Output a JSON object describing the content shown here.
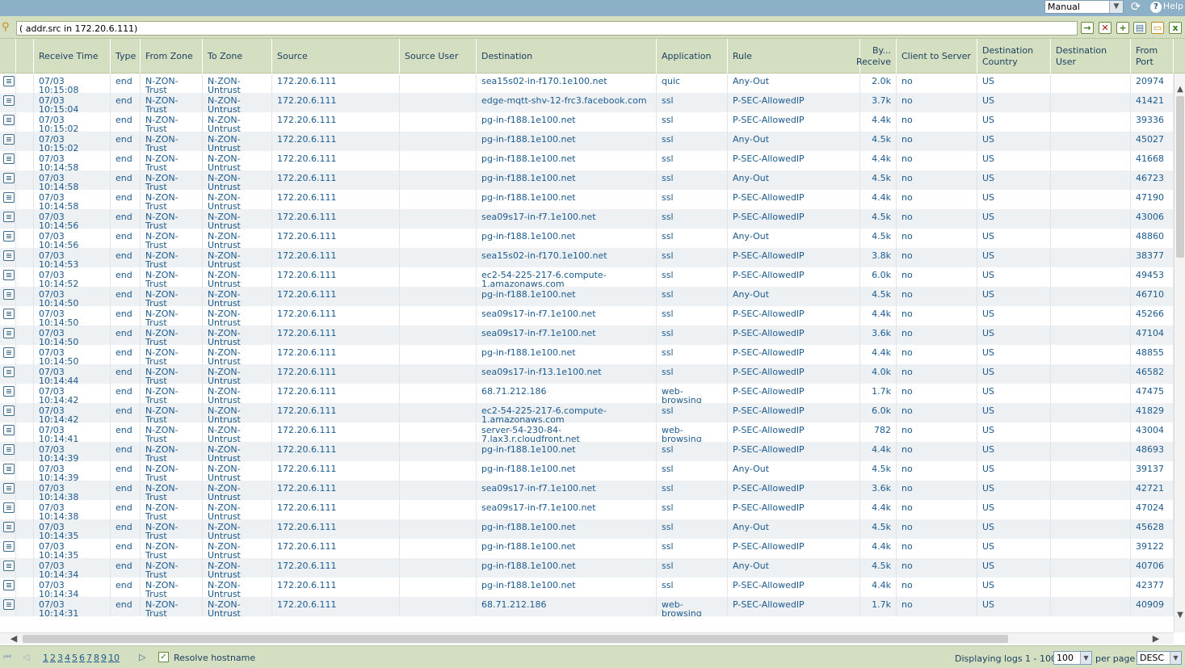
{
  "topbar": {
    "mode": "Manual",
    "help_label": "Help"
  },
  "filter": {
    "query": "( addr.src in 172.20.6.111)"
  },
  "columns": [
    {
      "key": "icon",
      "label": ""
    },
    {
      "key": "time",
      "label": "Receive Time"
    },
    {
      "key": "type",
      "label": "Type"
    },
    {
      "key": "from_zone",
      "label": "From Zone"
    },
    {
      "key": "to_zone",
      "label": "To Zone"
    },
    {
      "key": "source",
      "label": "Source"
    },
    {
      "key": "source_user",
      "label": "Source User"
    },
    {
      "key": "destination",
      "label": "Destination"
    },
    {
      "key": "application",
      "label": "Application"
    },
    {
      "key": "rule",
      "label": "Rule"
    },
    {
      "key": "bytes",
      "label": "By... Receive"
    },
    {
      "key": "c2s",
      "label": "Client to Server"
    },
    {
      "key": "dest_country",
      "label": "Destination Country"
    },
    {
      "key": "dest_user",
      "label": "Destination User"
    },
    {
      "key": "from_port",
      "label": "From Port"
    }
  ],
  "rows": [
    {
      "time": "07/03 10:15:08",
      "type": "end",
      "from_zone": "N-ZON-Trust",
      "to_zone": "N-ZON-Untrust",
      "source": "172.20.6.111",
      "source_user": "",
      "destination": "sea15s02-in-f170.1e100.net",
      "application": "quic",
      "rule": "Any-Out",
      "bytes": "2.0k",
      "c2s": "no",
      "dest_country": "US",
      "dest_user": "",
      "from_port": "20974"
    },
    {
      "time": "07/03 10:15:04",
      "type": "end",
      "from_zone": "N-ZON-Trust",
      "to_zone": "N-ZON-Untrust",
      "source": "172.20.6.111",
      "source_user": "",
      "destination": "edge-mqtt-shv-12-frc3.facebook.com",
      "application": "ssl",
      "rule": "P-SEC-AllowedIP",
      "bytes": "3.7k",
      "c2s": "no",
      "dest_country": "US",
      "dest_user": "",
      "from_port": "41421"
    },
    {
      "time": "07/03 10:15:02",
      "type": "end",
      "from_zone": "N-ZON-Trust",
      "to_zone": "N-ZON-Untrust",
      "source": "172.20.6.111",
      "source_user": "",
      "destination": "pg-in-f188.1e100.net",
      "application": "ssl",
      "rule": "P-SEC-AllowedIP",
      "bytes": "4.4k",
      "c2s": "no",
      "dest_country": "US",
      "dest_user": "",
      "from_port": "39336"
    },
    {
      "time": "07/03 10:15:02",
      "type": "end",
      "from_zone": "N-ZON-Trust",
      "to_zone": "N-ZON-Untrust",
      "source": "172.20.6.111",
      "source_user": "",
      "destination": "pg-in-f188.1e100.net",
      "application": "ssl",
      "rule": "Any-Out",
      "bytes": "4.5k",
      "c2s": "no",
      "dest_country": "US",
      "dest_user": "",
      "from_port": "45027"
    },
    {
      "time": "07/03 10:14:58",
      "type": "end",
      "from_zone": "N-ZON-Trust",
      "to_zone": "N-ZON-Untrust",
      "source": "172.20.6.111",
      "source_user": "",
      "destination": "pg-in-f188.1e100.net",
      "application": "ssl",
      "rule": "P-SEC-AllowedIP",
      "bytes": "4.4k",
      "c2s": "no",
      "dest_country": "US",
      "dest_user": "",
      "from_port": "41668"
    },
    {
      "time": "07/03 10:14:58",
      "type": "end",
      "from_zone": "N-ZON-Trust",
      "to_zone": "N-ZON-Untrust",
      "source": "172.20.6.111",
      "source_user": "",
      "destination": "pg-in-f188.1e100.net",
      "application": "ssl",
      "rule": "Any-Out",
      "bytes": "4.5k",
      "c2s": "no",
      "dest_country": "US",
      "dest_user": "",
      "from_port": "46723"
    },
    {
      "time": "07/03 10:14:58",
      "type": "end",
      "from_zone": "N-ZON-Trust",
      "to_zone": "N-ZON-Untrust",
      "source": "172.20.6.111",
      "source_user": "",
      "destination": "pg-in-f188.1e100.net",
      "application": "ssl",
      "rule": "P-SEC-AllowedIP",
      "bytes": "4.4k",
      "c2s": "no",
      "dest_country": "US",
      "dest_user": "",
      "from_port": "47190"
    },
    {
      "time": "07/03 10:14:56",
      "type": "end",
      "from_zone": "N-ZON-Trust",
      "to_zone": "N-ZON-Untrust",
      "source": "172.20.6.111",
      "source_user": "",
      "destination": "sea09s17-in-f7.1e100.net",
      "application": "ssl",
      "rule": "P-SEC-AllowedIP",
      "bytes": "4.5k",
      "c2s": "no",
      "dest_country": "US",
      "dest_user": "",
      "from_port": "43006"
    },
    {
      "time": "07/03 10:14:56",
      "type": "end",
      "from_zone": "N-ZON-Trust",
      "to_zone": "N-ZON-Untrust",
      "source": "172.20.6.111",
      "source_user": "",
      "destination": "pg-in-f188.1e100.net",
      "application": "ssl",
      "rule": "Any-Out",
      "bytes": "4.5k",
      "c2s": "no",
      "dest_country": "US",
      "dest_user": "",
      "from_port": "48860"
    },
    {
      "time": "07/03 10:14:53",
      "type": "end",
      "from_zone": "N-ZON-Trust",
      "to_zone": "N-ZON-Untrust",
      "source": "172.20.6.111",
      "source_user": "",
      "destination": "sea15s02-in-f170.1e100.net",
      "application": "ssl",
      "rule": "P-SEC-AllowedIP",
      "bytes": "3.8k",
      "c2s": "no",
      "dest_country": "US",
      "dest_user": "",
      "from_port": "38377"
    },
    {
      "time": "07/03 10:14:52",
      "type": "end",
      "from_zone": "N-ZON-Trust",
      "to_zone": "N-ZON-Untrust",
      "source": "172.20.6.111",
      "source_user": "",
      "destination": "ec2-54-225-217-6.compute-1.amazonaws.com",
      "application": "ssl",
      "rule": "P-SEC-AllowedIP",
      "bytes": "6.0k",
      "c2s": "no",
      "dest_country": "US",
      "dest_user": "",
      "from_port": "49453"
    },
    {
      "time": "07/03 10:14:50",
      "type": "end",
      "from_zone": "N-ZON-Trust",
      "to_zone": "N-ZON-Untrust",
      "source": "172.20.6.111",
      "source_user": "",
      "destination": "pg-in-f188.1e100.net",
      "application": "ssl",
      "rule": "Any-Out",
      "bytes": "4.5k",
      "c2s": "no",
      "dest_country": "US",
      "dest_user": "",
      "from_port": "46710"
    },
    {
      "time": "07/03 10:14:50",
      "type": "end",
      "from_zone": "N-ZON-Trust",
      "to_zone": "N-ZON-Untrust",
      "source": "172.20.6.111",
      "source_user": "",
      "destination": "sea09s17-in-f7.1e100.net",
      "application": "ssl",
      "rule": "P-SEC-AllowedIP",
      "bytes": "4.4k",
      "c2s": "no",
      "dest_country": "US",
      "dest_user": "",
      "from_port": "45266"
    },
    {
      "time": "07/03 10:14:50",
      "type": "end",
      "from_zone": "N-ZON-Trust",
      "to_zone": "N-ZON-Untrust",
      "source": "172.20.6.111",
      "source_user": "",
      "destination": "sea09s17-in-f7.1e100.net",
      "application": "ssl",
      "rule": "P-SEC-AllowedIP",
      "bytes": "3.6k",
      "c2s": "no",
      "dest_country": "US",
      "dest_user": "",
      "from_port": "47104"
    },
    {
      "time": "07/03 10:14:50",
      "type": "end",
      "from_zone": "N-ZON-Trust",
      "to_zone": "N-ZON-Untrust",
      "source": "172.20.6.111",
      "source_user": "",
      "destination": "pg-in-f188.1e100.net",
      "application": "ssl",
      "rule": "P-SEC-AllowedIP",
      "bytes": "4.4k",
      "c2s": "no",
      "dest_country": "US",
      "dest_user": "",
      "from_port": "48855"
    },
    {
      "time": "07/03 10:14:44",
      "type": "end",
      "from_zone": "N-ZON-Trust",
      "to_zone": "N-ZON-Untrust",
      "source": "172.20.6.111",
      "source_user": "",
      "destination": "sea09s17-in-f13.1e100.net",
      "application": "ssl",
      "rule": "P-SEC-AllowedIP",
      "bytes": "4.0k",
      "c2s": "no",
      "dest_country": "US",
      "dest_user": "",
      "from_port": "46582"
    },
    {
      "time": "07/03 10:14:42",
      "type": "end",
      "from_zone": "N-ZON-Trust",
      "to_zone": "N-ZON-Untrust",
      "source": "172.20.6.111",
      "source_user": "",
      "destination": "68.71.212.186",
      "application": "web-browsing",
      "rule": "P-SEC-AllowedIP",
      "bytes": "1.7k",
      "c2s": "no",
      "dest_country": "US",
      "dest_user": "",
      "from_port": "47475"
    },
    {
      "time": "07/03 10:14:42",
      "type": "end",
      "from_zone": "N-ZON-Trust",
      "to_zone": "N-ZON-Untrust",
      "source": "172.20.6.111",
      "source_user": "",
      "destination": "ec2-54-225-217-6.compute-1.amazonaws.com",
      "application": "ssl",
      "rule": "P-SEC-AllowedIP",
      "bytes": "6.0k",
      "c2s": "no",
      "dest_country": "US",
      "dest_user": "",
      "from_port": "41829"
    },
    {
      "time": "07/03 10:14:41",
      "type": "end",
      "from_zone": "N-ZON-Trust",
      "to_zone": "N-ZON-Untrust",
      "source": "172.20.6.111",
      "source_user": "",
      "destination": "server-54-230-84-7.lax3.r.cloudfront.net",
      "application": "web-browsing",
      "rule": "P-SEC-AllowedIP",
      "bytes": "782",
      "c2s": "no",
      "dest_country": "US",
      "dest_user": "",
      "from_port": "43004"
    },
    {
      "time": "07/03 10:14:39",
      "type": "end",
      "from_zone": "N-ZON-Trust",
      "to_zone": "N-ZON-Untrust",
      "source": "172.20.6.111",
      "source_user": "",
      "destination": "pg-in-f188.1e100.net",
      "application": "ssl",
      "rule": "P-SEC-AllowedIP",
      "bytes": "4.4k",
      "c2s": "no",
      "dest_country": "US",
      "dest_user": "",
      "from_port": "48693"
    },
    {
      "time": "07/03 10:14:39",
      "type": "end",
      "from_zone": "N-ZON-Trust",
      "to_zone": "N-ZON-Untrust",
      "source": "172.20.6.111",
      "source_user": "",
      "destination": "pg-in-f188.1e100.net",
      "application": "ssl",
      "rule": "Any-Out",
      "bytes": "4.5k",
      "c2s": "no",
      "dest_country": "US",
      "dest_user": "",
      "from_port": "39137"
    },
    {
      "time": "07/03 10:14:38",
      "type": "end",
      "from_zone": "N-ZON-Trust",
      "to_zone": "N-ZON-Untrust",
      "source": "172.20.6.111",
      "source_user": "",
      "destination": "sea09s17-in-f7.1e100.net",
      "application": "ssl",
      "rule": "P-SEC-AllowedIP",
      "bytes": "3.6k",
      "c2s": "no",
      "dest_country": "US",
      "dest_user": "",
      "from_port": "42721"
    },
    {
      "time": "07/03 10:14:38",
      "type": "end",
      "from_zone": "N-ZON-Trust",
      "to_zone": "N-ZON-Untrust",
      "source": "172.20.6.111",
      "source_user": "",
      "destination": "sea09s17-in-f7.1e100.net",
      "application": "ssl",
      "rule": "P-SEC-AllowedIP",
      "bytes": "4.4k",
      "c2s": "no",
      "dest_country": "US",
      "dest_user": "",
      "from_port": "47024"
    },
    {
      "time": "07/03 10:14:35",
      "type": "end",
      "from_zone": "N-ZON-Trust",
      "to_zone": "N-ZON-Untrust",
      "source": "172.20.6.111",
      "source_user": "",
      "destination": "pg-in-f188.1e100.net",
      "application": "ssl",
      "rule": "Any-Out",
      "bytes": "4.5k",
      "c2s": "no",
      "dest_country": "US",
      "dest_user": "",
      "from_port": "45628"
    },
    {
      "time": "07/03 10:14:35",
      "type": "end",
      "from_zone": "N-ZON-Trust",
      "to_zone": "N-ZON-Untrust",
      "source": "172.20.6.111",
      "source_user": "",
      "destination": "pg-in-f188.1e100.net",
      "application": "ssl",
      "rule": "P-SEC-AllowedIP",
      "bytes": "4.4k",
      "c2s": "no",
      "dest_country": "US",
      "dest_user": "",
      "from_port": "39122"
    },
    {
      "time": "07/03 10:14:34",
      "type": "end",
      "from_zone": "N-ZON-Trust",
      "to_zone": "N-ZON-Untrust",
      "source": "172.20.6.111",
      "source_user": "",
      "destination": "pg-in-f188.1e100.net",
      "application": "ssl",
      "rule": "Any-Out",
      "bytes": "4.5k",
      "c2s": "no",
      "dest_country": "US",
      "dest_user": "",
      "from_port": "40706"
    },
    {
      "time": "07/03 10:14:34",
      "type": "end",
      "from_zone": "N-ZON-Trust",
      "to_zone": "N-ZON-Untrust",
      "source": "172.20.6.111",
      "source_user": "",
      "destination": "pg-in-f188.1e100.net",
      "application": "ssl",
      "rule": "P-SEC-AllowedIP",
      "bytes": "4.4k",
      "c2s": "no",
      "dest_country": "US",
      "dest_user": "",
      "from_port": "42377"
    },
    {
      "time": "07/03 10:14:31",
      "type": "end",
      "from_zone": "N-ZON-Trust",
      "to_zone": "N-ZON-Untrust",
      "source": "172.20.6.111",
      "source_user": "",
      "destination": "68.71.212.186",
      "application": "web-browsing",
      "rule": "P-SEC-AllowedIP",
      "bytes": "1.7k",
      "c2s": "no",
      "dest_country": "US",
      "dest_user": "",
      "from_port": "40909"
    }
  ],
  "footer": {
    "pages": [
      "1",
      "2",
      "3",
      "4",
      "5",
      "6",
      "7",
      "8",
      "9",
      "10"
    ],
    "resolve_label": "Resolve hostname",
    "display_label": "Displaying logs 1 - 100",
    "per_page_value": "100",
    "per_page_label": "per page",
    "order_value": "DESC"
  },
  "colors": {
    "header_bg": "#d4dfc2",
    "topbar_bg": "#8cb0c6",
    "link_text": "#1d5a8e",
    "alt_row": "#eef1f4"
  }
}
